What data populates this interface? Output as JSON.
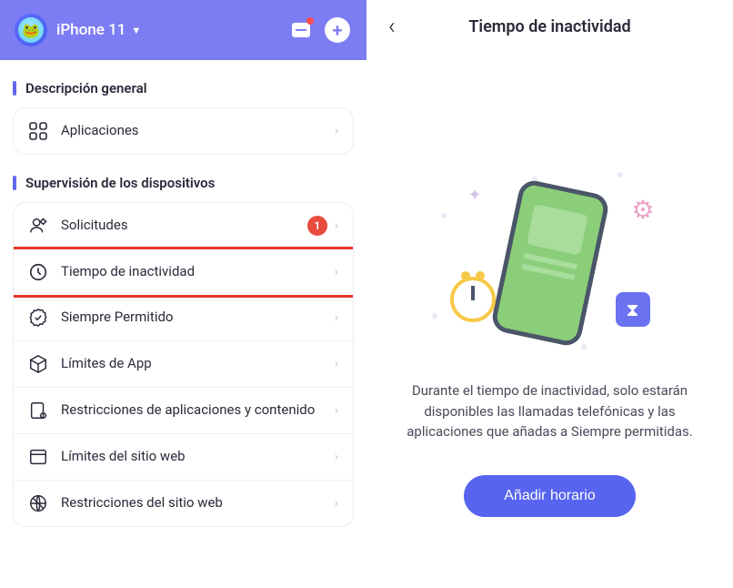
{
  "header": {
    "device_name": "iPhone 11"
  },
  "sections": {
    "overview": {
      "title": "Descripción general",
      "apps_label": "Aplicaciones"
    },
    "supervision": {
      "title": "Supervisión de los dispositivos",
      "requests_label": "Solicitudes",
      "requests_badge": "1",
      "downtime_label": "Tiempo de inactividad",
      "always_allowed_label": "Siempre Permitido",
      "app_limits_label": "Límites de App",
      "content_restrictions_label": "Restricciones de aplicaciones y contenido",
      "web_limits_label": "Límites del sitio web",
      "web_restrictions_label": "Restricciones del sitio web"
    }
  },
  "detail": {
    "title": "Tiempo de inactividad",
    "description": "Durante el tiempo de inactividad, solo estarán disponibles las llamadas telefónicas y las aplicaciones que añadas a Siempre permitidas.",
    "cta_label": "Añadir horario"
  }
}
